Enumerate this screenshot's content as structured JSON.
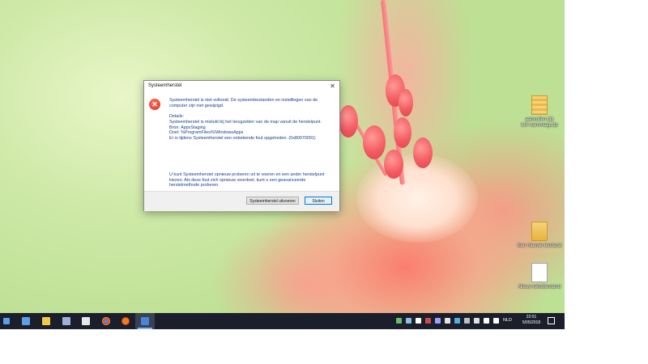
{
  "dialog": {
    "title": "Systeemherstel",
    "close_glyph": "✕",
    "icon": "error-icon",
    "main_message": "Systeemherstel is niet voltooid. De systeembestanden en instellingen van de computer zijn niet gewijzigd.",
    "details_heading": "Details:",
    "details_lines": [
      "Systeemherstel is mislukt bij het terugzetten van de map vanuit de herstelpunt.",
      "Bron: AppxStaging",
      "Doel: %ProgramFiles%\\WindowsApps",
      "Er is tijdens Systeemherstel een onbekende fout opgetreden. (0x80070091)"
    ],
    "footer_message": "U kunt Systeemherstel opnieuw proberen uit te voeren en een ander herstelpunt kiezen. Als deze fout zich opnieuw voordoet, kunt u een geavanceerde herstelmethode proberen.",
    "restore_button": "Systeemherstel uitvoeren",
    "close_button": "Sluiten"
  },
  "desktop": {
    "icons": [
      {
        "name": "zip-icon",
        "label": "aanvullen (1)\nLIU aanvraag.zip"
      },
      {
        "name": "folder-icon",
        "label": "Een nieuwe bestand"
      },
      {
        "name": "document-icon",
        "label": "Nieuw tekstbestand"
      }
    ]
  },
  "taskbar": {
    "apps": [
      {
        "name": "store-icon",
        "color": "#5aa0e6"
      },
      {
        "name": "file-explorer-icon",
        "color": "#f2c94c"
      },
      {
        "name": "media-icon",
        "color": "#9db2d6"
      },
      {
        "name": "mail-icon",
        "color": "#e8e8e8"
      },
      {
        "name": "chrome-icon",
        "color": "#e04a3b"
      },
      {
        "name": "firefox-icon",
        "color": "#f47a20"
      },
      {
        "name": "system-restore-icon",
        "color": "#4a84d8"
      }
    ],
    "language": "NLD",
    "time": "22:01",
    "date": "5/05/2018"
  }
}
